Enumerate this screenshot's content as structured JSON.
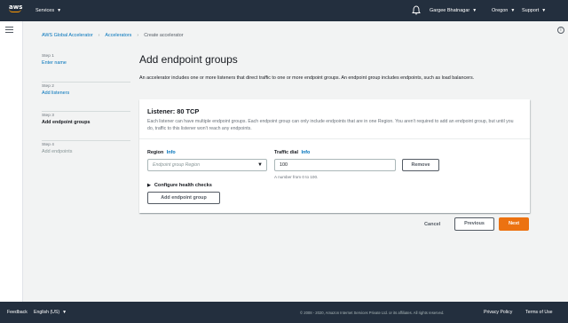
{
  "header": {
    "logo_text": "aws",
    "services_label": "Services",
    "user_label": "Gargee Bhatnagar",
    "region_label": "Oregon",
    "support_label": "Support"
  },
  "breadcrumb": {
    "items": [
      "AWS Global Accelerator",
      "Accelerators",
      "Create accelerator"
    ]
  },
  "steps": [
    {
      "num": "Step 1",
      "label": "Enter name"
    },
    {
      "num": "Step 2",
      "label": "Add listeners"
    },
    {
      "num": "Step 3",
      "label": "Add endpoint groups"
    },
    {
      "num": "Step 4",
      "label": "Add endpoints"
    }
  ],
  "page": {
    "title": "Add endpoint groups",
    "description": "An accelerator includes one or more listeners that direct traffic to one or more endpoint groups. An endpoint group includes endpoints, such as load balancers."
  },
  "listener": {
    "title": "Listener: 80 TCP",
    "description": "Each listener can have multiple endpoint groups. Each endpoint group can only include endpoints that are in one Region. You aren't required to add an endpoint group, but until you do, traffic to this listener won't reach any endpoints.",
    "region_label": "Region",
    "info": "Info",
    "region_placeholder": "Endpoint group Region",
    "dial_label": "Traffic dial",
    "dial_value": "100",
    "dial_hint": "A number from 0 to 100.",
    "remove_label": "Remove",
    "health_label": "Configure health checks",
    "add_group_label": "Add endpoint group"
  },
  "actions": {
    "cancel": "Cancel",
    "previous": "Previous",
    "next": "Next"
  },
  "footer": {
    "feedback": "Feedback",
    "language": "English (US)",
    "copyright": "© 2008 - 2020, Amazon Internet Services Private Ltd. or its affiliates. All rights reserved.",
    "privacy": "Privacy Policy",
    "terms": "Terms of Use"
  },
  "colors": {
    "header_bg": "#232f3e",
    "link": "#0073bb",
    "primary": "#ec7211",
    "page_bg": "#f2f3f3"
  }
}
